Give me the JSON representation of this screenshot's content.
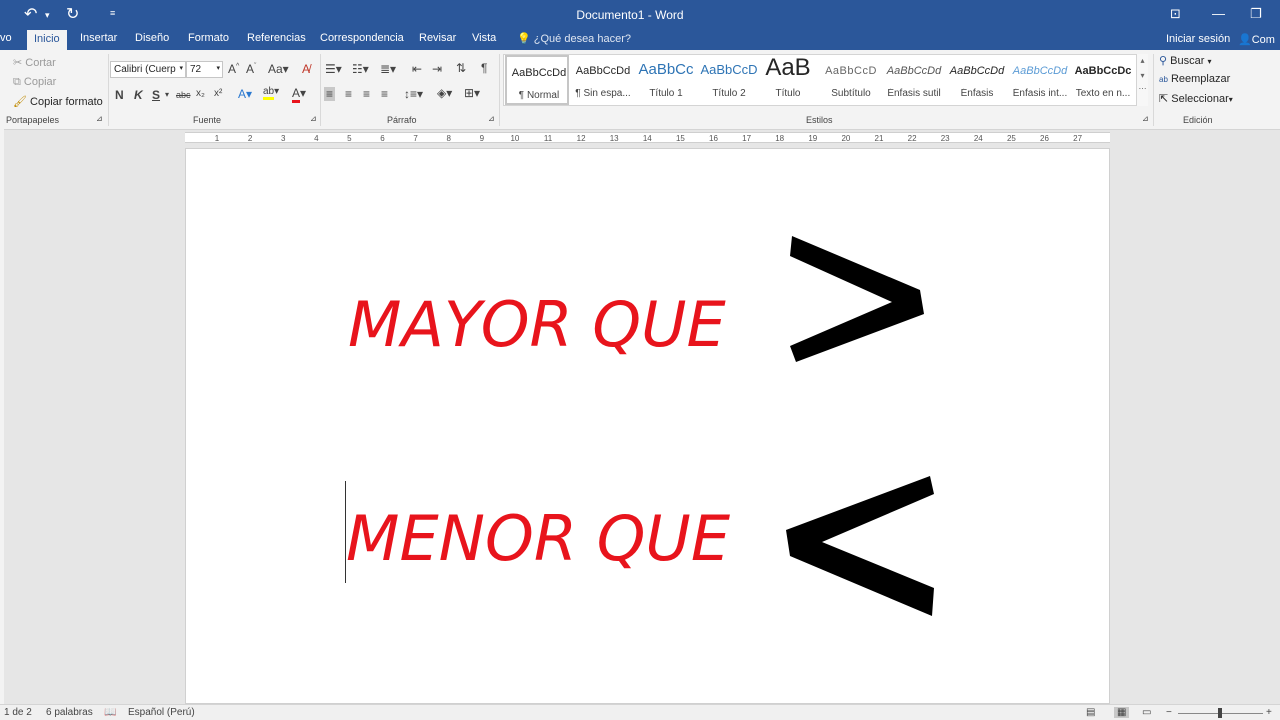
{
  "window": {
    "title": "Documento1 - Word"
  },
  "tabs": [
    "vo",
    "Inicio",
    "Insertar",
    "Diseño",
    "Formato",
    "Referencias",
    "Correspondencia",
    "Revisar",
    "Vista"
  ],
  "tell_me": "¿Qué desea hacer?",
  "account": {
    "signin": "Iniciar sesión",
    "share": "Com"
  },
  "clipboard": {
    "cut": "Cortar",
    "copy": "Copiar",
    "format_painter": "Copiar formato",
    "label": "Portapapeles"
  },
  "font": {
    "name": "Calibri (Cuerp",
    "size": "72",
    "bold": "N",
    "italic": "K",
    "underline": "S",
    "strike": "abc",
    "sub": "x₂",
    "sup": "x²",
    "label": "Fuente",
    "color_hex": "#e8141c"
  },
  "paragraph": {
    "label": "Párrafo"
  },
  "styles": {
    "label": "Estilos",
    "items": [
      {
        "sample": "AaBbCcDd",
        "name": "¶ Normal"
      },
      {
        "sample": "AaBbCcDd",
        "name": "¶ Sin espa..."
      },
      {
        "sample": "AaBbCc",
        "name": "Título 1"
      },
      {
        "sample": "AaBbCcD",
        "name": "Título 2"
      },
      {
        "sample": "AaB",
        "name": "Título"
      },
      {
        "sample": "AaBbCcD",
        "name": "Subtítulo"
      },
      {
        "sample": "AaBbCcDd",
        "name": "Énfasis sutil"
      },
      {
        "sample": "AaBbCcDd",
        "name": "Énfasis"
      },
      {
        "sample": "AaBbCcDd",
        "name": "Énfasis int..."
      },
      {
        "sample": "AaBbCcDc",
        "name": "Texto en n..."
      }
    ]
  },
  "editing": {
    "find": "Buscar",
    "replace": "Reemplazar",
    "select": "Seleccionar",
    "label": "Edición"
  },
  "ruler": [
    "1",
    "2",
    "3",
    "4",
    "5",
    "6",
    "7",
    "8",
    "9",
    "10",
    "11",
    "12",
    "13",
    "14",
    "15",
    "16",
    "17",
    "18",
    "19",
    "20",
    "21",
    "22",
    "23",
    "24",
    "25",
    "26",
    "27"
  ],
  "document": {
    "line1": "MAYOR QUE",
    "line2": "MENOR QUE",
    "text_color": "#e8141c"
  },
  "status": {
    "page": "1 de 2",
    "words": "6 palabras",
    "language": "Español (Perú)"
  }
}
